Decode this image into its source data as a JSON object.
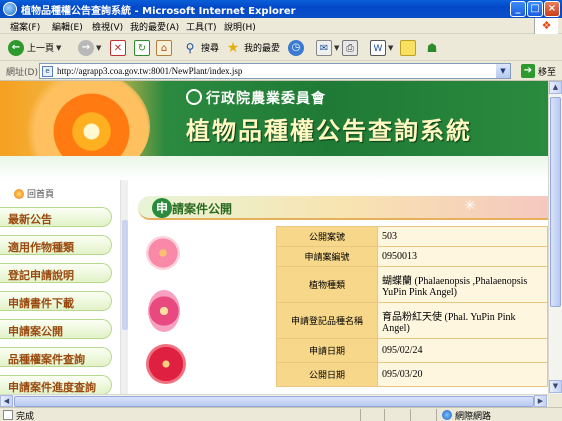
{
  "window": {
    "title": "植物品種權公告查詢系統 - Microsoft Internet Explorer"
  },
  "menu": [
    "檔案(F)",
    "編輯(E)",
    "檢視(V)",
    "我的最愛(A)",
    "工具(T)",
    "說明(H)"
  ],
  "toolbar": {
    "back": "上一頁",
    "search": "搜尋",
    "favorites": "我的最愛"
  },
  "address": {
    "label": "網址(D)",
    "url": "http://agrapp3.coa.gov.tw:8001/NewPlant/index.jsp",
    "go": "移至"
  },
  "banner": {
    "agency": "行政院農業委員會",
    "system": "植物品種權公告查詢系統"
  },
  "sidebar": {
    "home": "回首頁",
    "items": [
      "最新公告",
      "適用作物種類",
      "登記申請說明",
      "申請書件下載",
      "申請案公開",
      "品種權案件查詢",
      "申請案件進度查詢"
    ]
  },
  "panel": {
    "badge": "申",
    "title": "請案件公開",
    "rows": [
      {
        "k": "公開案號",
        "v": "503"
      },
      {
        "k": "申請案編號",
        "v": "0950013"
      },
      {
        "k": "植物種類",
        "v": "蝴蝶蘭 (Phalaenopsis ,Phalaenopsis YuPin Pink Angel)"
      },
      {
        "k": "申請登記品種名稱",
        "v": "育品粉紅天使 (Phal. YuPin Pink Angel)"
      },
      {
        "k": "申請日期",
        "v": "095/02/24"
      },
      {
        "k": "公開日期",
        "v": "095/03/20"
      }
    ]
  },
  "status": {
    "text": "完成",
    "zone": "網際網路"
  },
  "colors": {
    "titlebar": "#0348c8",
    "banner_green": "#2a8a3e",
    "table_key": "#f7d78a",
    "table_val": "#fff6e0",
    "nav_text": "#9a4a10"
  }
}
